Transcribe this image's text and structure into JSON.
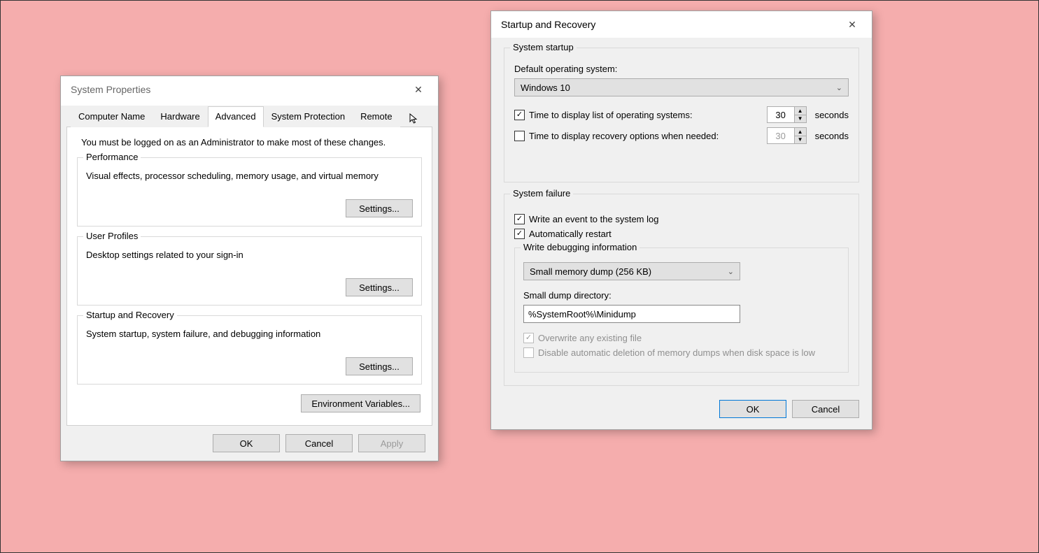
{
  "sysprops": {
    "title": "System Properties",
    "tabs": [
      "Computer Name",
      "Hardware",
      "Advanced",
      "System Protection",
      "Remote"
    ],
    "active_tab": "Advanced",
    "lead": "You must be logged on as an Administrator to make most of these changes.",
    "performance": {
      "legend": "Performance",
      "desc": "Visual effects, processor scheduling, memory usage, and virtual memory",
      "settings_label": "Settings..."
    },
    "user_profiles": {
      "legend": "User Profiles",
      "desc": "Desktop settings related to your sign-in",
      "settings_label": "Settings..."
    },
    "startup_recovery": {
      "legend": "Startup and Recovery",
      "desc": "System startup, system failure, and debugging information",
      "settings_label": "Settings..."
    },
    "env_vars_label": "Environment Variables...",
    "ok_label": "OK",
    "cancel_label": "Cancel",
    "apply_label": "Apply"
  },
  "recovery": {
    "title": "Startup and Recovery",
    "system_startup": {
      "legend": "System startup",
      "default_os_label": "Default operating system:",
      "default_os_value": "Windows 10",
      "time_list_label": "Time to display list of operating systems:",
      "time_list_checked": true,
      "time_list_value": "30",
      "time_recovery_label": "Time to display recovery options when needed:",
      "time_recovery_checked": false,
      "time_recovery_value": "30",
      "seconds_label": "seconds"
    },
    "system_failure": {
      "legend": "System failure",
      "write_event_label": "Write an event to the system log",
      "write_event_checked": true,
      "auto_restart_label": "Automatically restart",
      "auto_restart_checked": true,
      "debug_legend": "Write debugging information",
      "dump_type_value": "Small memory dump (256 KB)",
      "dump_dir_label": "Small dump directory:",
      "dump_dir_value": "%SystemRoot%\\Minidump",
      "overwrite_label": "Overwrite any existing file",
      "overwrite_checked": true,
      "overwrite_enabled": false,
      "disable_auto_delete_label": "Disable automatic deletion of memory dumps when disk space is low",
      "disable_auto_delete_checked": false,
      "disable_auto_delete_enabled": false
    },
    "ok_label": "OK",
    "cancel_label": "Cancel"
  }
}
